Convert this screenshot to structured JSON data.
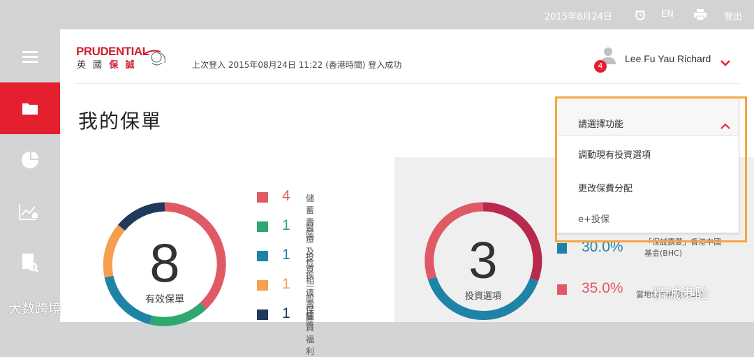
{
  "topbar": {
    "date": "2015年8月24日",
    "language": "EN",
    "logout": "登出"
  },
  "header": {
    "logo_text": "PRUDENTIAL",
    "logo_chars": [
      "英",
      "國",
      "保",
      "誠"
    ],
    "last_login": "上次登入 2015年08月24日 11:22 (香港時間) 登入成功",
    "user_name": "Lee Fu Yau Richard",
    "notification_count": "4"
  },
  "page": {
    "title": "我的保單"
  },
  "policies": {
    "total": "8",
    "label": "有效保單",
    "items": [
      {
        "count": "4",
        "label": "儲蓄壽險",
        "color": "#e05a66"
      },
      {
        "count": "1",
        "label": "醫療及危疾",
        "color": "#2ea86e"
      },
      {
        "count": "1",
        "label": "投資相連壽險",
        "color": "#1f83a8"
      },
      {
        "count": "1",
        "label": "一般保險",
        "color": "#f4a04e"
      },
      {
        "count": "1",
        "label": "僱員福利",
        "color": "#1f3a5a"
      }
    ]
  },
  "investments": {
    "total": "3",
    "label": "投資選項",
    "funds": [
      {
        "percent": "30.0%",
        "name_line1": "「保誠霸菱」香港中國",
        "name_line2": "基金(BHC)",
        "color": "#1f83a8"
      },
      {
        "percent": "35.0%",
        "name_line1": "",
        "name_line2": "當地債券基金(ALB)",
        "color": "#e05a66"
      }
    ]
  },
  "function_menu": {
    "placeholder": "請選擇功能",
    "items": [
      "調動現有投資選項",
      "更改保費分配",
      "e+投保"
    ]
  },
  "watermarks": {
    "left": "大数跨境",
    "right": "精诚港险"
  }
}
